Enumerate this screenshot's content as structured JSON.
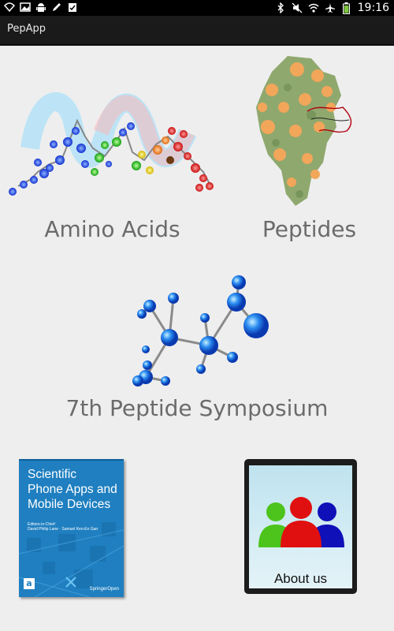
{
  "status_bar": {
    "time": "19:16",
    "left_icons": [
      "wifi-signal-icon",
      "image-icon",
      "android-icon",
      "pencil-icon",
      "clipboard-check-icon"
    ],
    "right_icons": [
      "bluetooth-icon",
      "mute-icon",
      "wifi-icon",
      "airplane-icon",
      "battery-icon"
    ],
    "battery_color": "#7ec242"
  },
  "action_bar": {
    "title": "PepApp"
  },
  "tiles": {
    "amino_acids": {
      "label": "Amino Acids"
    },
    "peptides": {
      "label": "Peptides"
    },
    "symposium": {
      "label": "7th Peptide Symposium"
    },
    "book": {
      "title_line1": "Scientific",
      "title_line2": "Phone Apps and",
      "title_line3": "Mobile Devices",
      "editors_heading": "Editors-in-Chief:",
      "editors_names": "David Philip Lane · Samuel Ken-En Gan",
      "publisher": "SpringerOpen"
    },
    "about": {
      "label": "About us"
    }
  },
  "colors": {
    "background": "#eeeeee",
    "action_bar": "#1a1a1a",
    "label_text": "#6b6b6b",
    "book_blue": "#1f7fc0",
    "about_green": "#4cc41c",
    "about_red": "#e01010",
    "about_blue": "#1010b8"
  }
}
